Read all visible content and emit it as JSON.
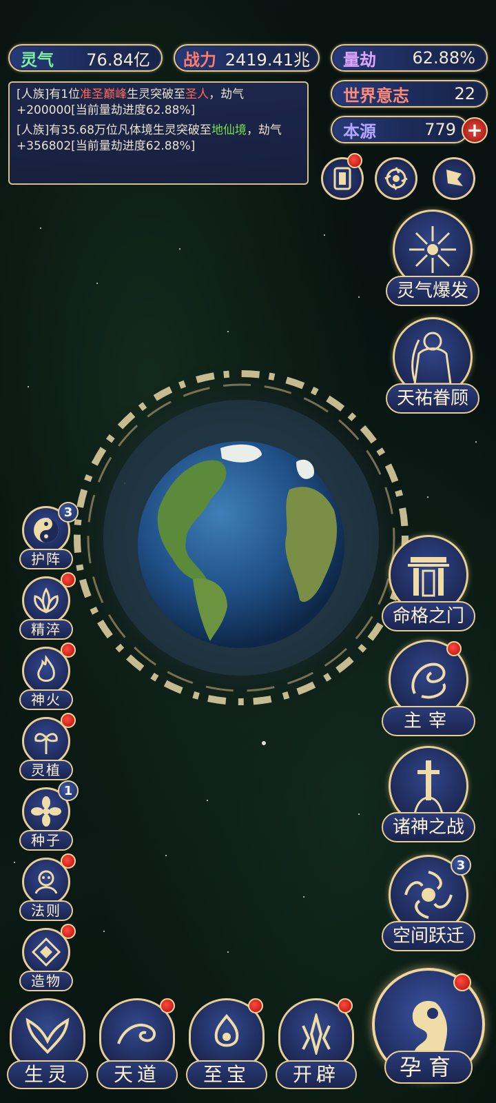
{
  "stats": {
    "lingqi": {
      "label": "灵气",
      "value": "76.84亿"
    },
    "zhanli": {
      "label": "战力",
      "value": "2419.41兆"
    },
    "liangjie": {
      "label": "量劫",
      "value": "62.88%"
    },
    "shijie": {
      "label": "世界意志",
      "value": "22"
    },
    "benyuan": {
      "label": "本源",
      "value": "779"
    }
  },
  "log": {
    "entry1": {
      "p1": "[人族]有1位",
      "realm_from": "准圣巅峰",
      "p2": "生灵突破至",
      "realm_to": "圣人",
      "p3": "，劫气+200000[当前量劫进度62.88%]"
    },
    "entry2": {
      "p1": "[人族]有35.68万位凡体境生灵突破至",
      "realm_to": "地仙境",
      "p3": "，劫气+356802[当前量劫进度62.88%]"
    }
  },
  "right_buttons": {
    "b1": "灵气爆发",
    "b2": "天祐眷顾",
    "b3": "命格之门",
    "b4": "主宰",
    "b5": "诸神之战",
    "b6": "空间跃迁",
    "b6_badge": "3"
  },
  "left_buttons": {
    "l1": "护阵",
    "l1_badge": "3",
    "l2": "精淬",
    "l3": "神火",
    "l4": "灵植",
    "l5": "种子",
    "l5_badge": "1",
    "l6": "法则",
    "l7": "造物"
  },
  "bottom_nav": {
    "n1": "生灵",
    "n2": "天道",
    "n3": "至宝",
    "n4": "开辟",
    "main": "孕育"
  },
  "colors": {
    "gold": "#e8cf91",
    "panel_blue": "#1c2b59",
    "red_dot": "#d21818",
    "highlight_red": "#ff6a5a",
    "highlight_green": "#77e04c"
  }
}
